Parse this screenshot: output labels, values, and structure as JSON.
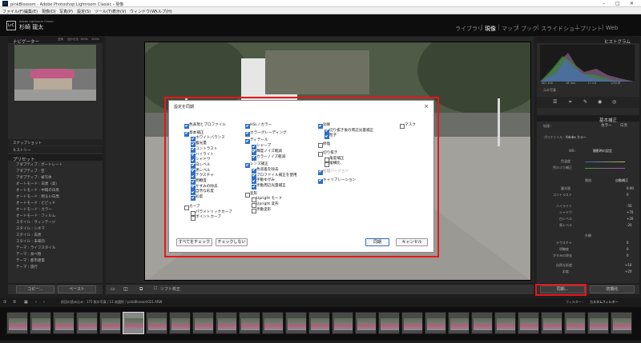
{
  "window": {
    "title": "pinkBlossom - Adobe Photoshop Lightroom Classic - 現像"
  },
  "menu": [
    "ファイル(F)",
    "編集(E)",
    "現像(D)",
    "写真(P)",
    "設定(S)",
    "ツール(T)",
    "表示(V)",
    "ウィンドウ(W)",
    "ヘルプ(H)"
  ],
  "identity": {
    "badge": "LrC",
    "line1": "Adobe Lightroom Classic",
    "name": "杉崎 龍太"
  },
  "modules": [
    "ライブラリ",
    "現像",
    "マップ",
    "ブック",
    "スライドショー",
    "プリント",
    "Web"
  ],
  "active_module": "現像",
  "left": {
    "navigator": "ナビゲーター",
    "nav_zoom": [
      "全体",
      "合わせる",
      "100%",
      "300%"
    ],
    "snapshots": "スナップショット",
    "history": "ヒストリー",
    "presets_title": "プリセット",
    "presets": [
      "アダプティブ : ポートレート",
      "アダプティブ : 空",
      "アダプティブ : 被写体",
      "オートモード : 白黒（高）",
      "オートモード : 中間の白黒",
      "オートモード : 明るい白黒",
      "オートモード : ビビッド",
      "オートモード : カラー",
      "オートモード : フィルム",
      "スタイル : ヴィンテージ",
      "スタイル : シネマ",
      "スタイル : 白黒",
      "スタイル : 未来的",
      "テーマ : ライフスタイル",
      "テーマ : 食べ物",
      "テーマ : 都市建築",
      "テーマ : 旅行"
    ],
    "copy_btn": "コピー...",
    "paste_btn": "ペースト"
  },
  "right": {
    "histogram": "ヒストグラム",
    "hist_vals": [
      "ISO 100",
      "16 mm",
      "f / 4.0",
      "1/30 秒"
    ],
    "original": "元の写真",
    "basic": "基本補正",
    "color_btn": "カラー",
    "bw_btn": "白黒",
    "profile_label": "プロファイル :",
    "profile_value": "Adobe カラー",
    "wb_label": "WB :",
    "wb_value": "撮影時の設定",
    "temp": "色温度",
    "tint": "色かぶり補正",
    "tone": "階調",
    "auto": "自動補正",
    "sliders": [
      "露光量",
      "コントラスト",
      "ハイライト",
      "シャドウ",
      "白レベル",
      "黒レベル"
    ],
    "slider_vals": [
      "0.00",
      "0",
      "-50",
      "+70",
      "+20",
      "-20"
    ],
    "presence": "外観",
    "presence_items": [
      "テクスチャ",
      "明瞭度",
      "かすみの除去",
      "自然な彩度",
      "彩度"
    ],
    "presence_vals": [
      "0",
      "0",
      "0",
      "+16",
      "+20"
    ],
    "sync_btn": "同期...",
    "reset_btn": "初期化"
  },
  "toolbar": {
    "softproof": "ソフト校正"
  },
  "filmstrip": {
    "info": "前回の読み込み : 175 枚の写真 / 11 枚選択 / pinkBlossom021.ARW",
    "filter_label": "フィルター :",
    "filter_value": "カスタムフィルター"
  },
  "dialog": {
    "title": "設定を同期",
    "col1": [
      {
        "label": "色表現とプロファイル",
        "on": true,
        "indent": 0
      },
      {
        "label": "基本補正",
        "on": true,
        "indent": 0
      },
      {
        "label": "ホワイトバランス",
        "on": true,
        "indent": 1
      },
      {
        "label": "露光量",
        "on": true,
        "indent": 1
      },
      {
        "label": "コントラスト",
        "on": true,
        "indent": 1
      },
      {
        "label": "ハイライト",
        "on": true,
        "indent": 1
      },
      {
        "label": "シャドウ",
        "on": true,
        "indent": 1
      },
      {
        "label": "白レベル",
        "on": true,
        "indent": 1
      },
      {
        "label": "黒レベル",
        "on": true,
        "indent": 1
      },
      {
        "label": "テクスチャ",
        "on": true,
        "indent": 1
      },
      {
        "label": "明瞭度",
        "on": true,
        "indent": 1
      },
      {
        "label": "かすみの除去",
        "on": true,
        "indent": 1
      },
      {
        "label": "自然な彩度",
        "on": true,
        "indent": 1
      },
      {
        "label": "彩度",
        "on": true,
        "indent": 1
      },
      {
        "label": "カーブ",
        "on": false,
        "indent": 0
      },
      {
        "label": "パラメトリックカーブ",
        "on": false,
        "indent": 1
      },
      {
        "label": "ポイントカーブ",
        "on": false,
        "indent": 1
      }
    ],
    "col2": [
      {
        "label": "HSL / カラー",
        "on": true,
        "indent": 0
      },
      {
        "label": "カラーグレーディング",
        "on": true,
        "indent": 0
      },
      {
        "label": "ディテール",
        "on": true,
        "indent": 0
      },
      {
        "label": "シャープ",
        "on": true,
        "indent": 1
      },
      {
        "label": "輝度ノイズ軽減",
        "on": true,
        "indent": 1
      },
      {
        "label": "カラーノイズ軽減",
        "on": true,
        "indent": 1
      },
      {
        "label": "レンズ補正",
        "on": true,
        "indent": 0
      },
      {
        "label": "色収差を除去",
        "on": true,
        "indent": 1
      },
      {
        "label": "プロファイル補正を使用",
        "on": true,
        "indent": 1
      },
      {
        "label": "手動ゆがみ",
        "on": true,
        "indent": 1
      },
      {
        "label": "手動周辺光量補正",
        "on": true,
        "indent": 1
      },
      {
        "label": "変形",
        "on": false,
        "indent": 0
      },
      {
        "label": "Upright モード",
        "on": false,
        "indent": 1
      },
      {
        "label": "Upright 変形",
        "on": false,
        "indent": 1
      },
      {
        "label": "手動変形",
        "on": false,
        "indent": 1
      }
    ],
    "col3": [
      {
        "label": "効果",
        "on": true,
        "indent": 0
      },
      {
        "label": "切り抜き後の周辺光量補正",
        "on": true,
        "indent": 1
      },
      {
        "label": "粒子",
        "on": true,
        "indent": 1
      },
      {
        "label": "修復",
        "on": false,
        "indent": 0
      },
      {
        "label": "切り抜き",
        "on": false,
        "indent": 0
      },
      {
        "label": "角度補正",
        "on": false,
        "indent": 1
      },
      {
        "label": "縦横比",
        "on": false,
        "indent": 1
      },
      {
        "label": "処理バージョン",
        "on": true,
        "indent": 0,
        "dim": true
      },
      {
        "label": "キャリブレーション",
        "on": true,
        "indent": 0
      }
    ],
    "col4": [
      {
        "label": "マスク",
        "on": false,
        "indent": 0
      }
    ],
    "check_all": "すべてをチェック",
    "check_none": "チェックしない",
    "sync": "同期",
    "cancel": "キャンセル"
  },
  "colors": {
    "highlight": "#e8161b",
    "checkbox": "#2f6fc4"
  }
}
